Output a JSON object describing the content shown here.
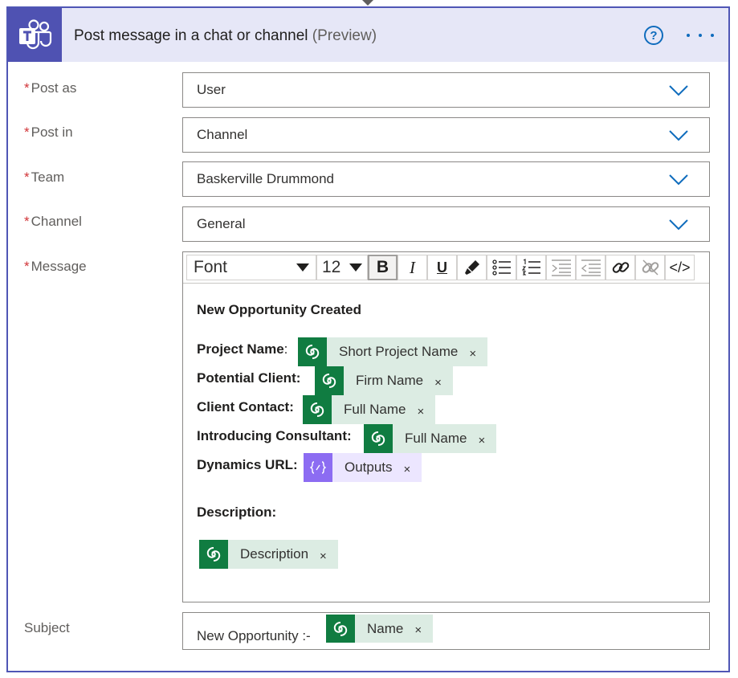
{
  "header": {
    "title": "Post message in a chat or channel",
    "preview": "(Preview)",
    "help_symbol": "?",
    "app_icon": "teams-icon",
    "accent_color": "#4f52b2"
  },
  "fields": {
    "post_as": {
      "label": "Post as",
      "required": "*",
      "value": "User"
    },
    "post_in": {
      "label": "Post in",
      "required": "*",
      "value": "Channel"
    },
    "team": {
      "label": "Team",
      "required": "*",
      "value": "Baskerville Drummond"
    },
    "channel": {
      "label": "Channel",
      "required": "*",
      "value": "General"
    },
    "message": {
      "label": "Message",
      "required": "*"
    },
    "subject": {
      "label": "Subject",
      "prefix": "New Opportunity :-"
    }
  },
  "toolbar": {
    "font": "Font",
    "size": "12",
    "bold": "B",
    "italic": "I",
    "underline": "U",
    "code": "</>"
  },
  "message_body": {
    "heading": "New Opportunity Created",
    "project_name_label": "Project Name",
    "project_name_colon": ":",
    "potential_client_label": "Potential Client:",
    "client_contact_label": "Client Contact:",
    "introducing_consultant_label": "Introducing Consultant:",
    "dynamics_url_label": "Dynamics URL:",
    "description_label": "Description:"
  },
  "tokens": {
    "short_project_name": "Short Project Name",
    "firm_name": "Firm Name",
    "client_full_name": "Full Name",
    "consultant_full_name": "Full Name",
    "outputs": "Outputs",
    "description": "Description",
    "subject_name": "Name",
    "close_glyph": "×",
    "dataverse_color": "#107c41",
    "expression_color": "#8c6cf2"
  }
}
